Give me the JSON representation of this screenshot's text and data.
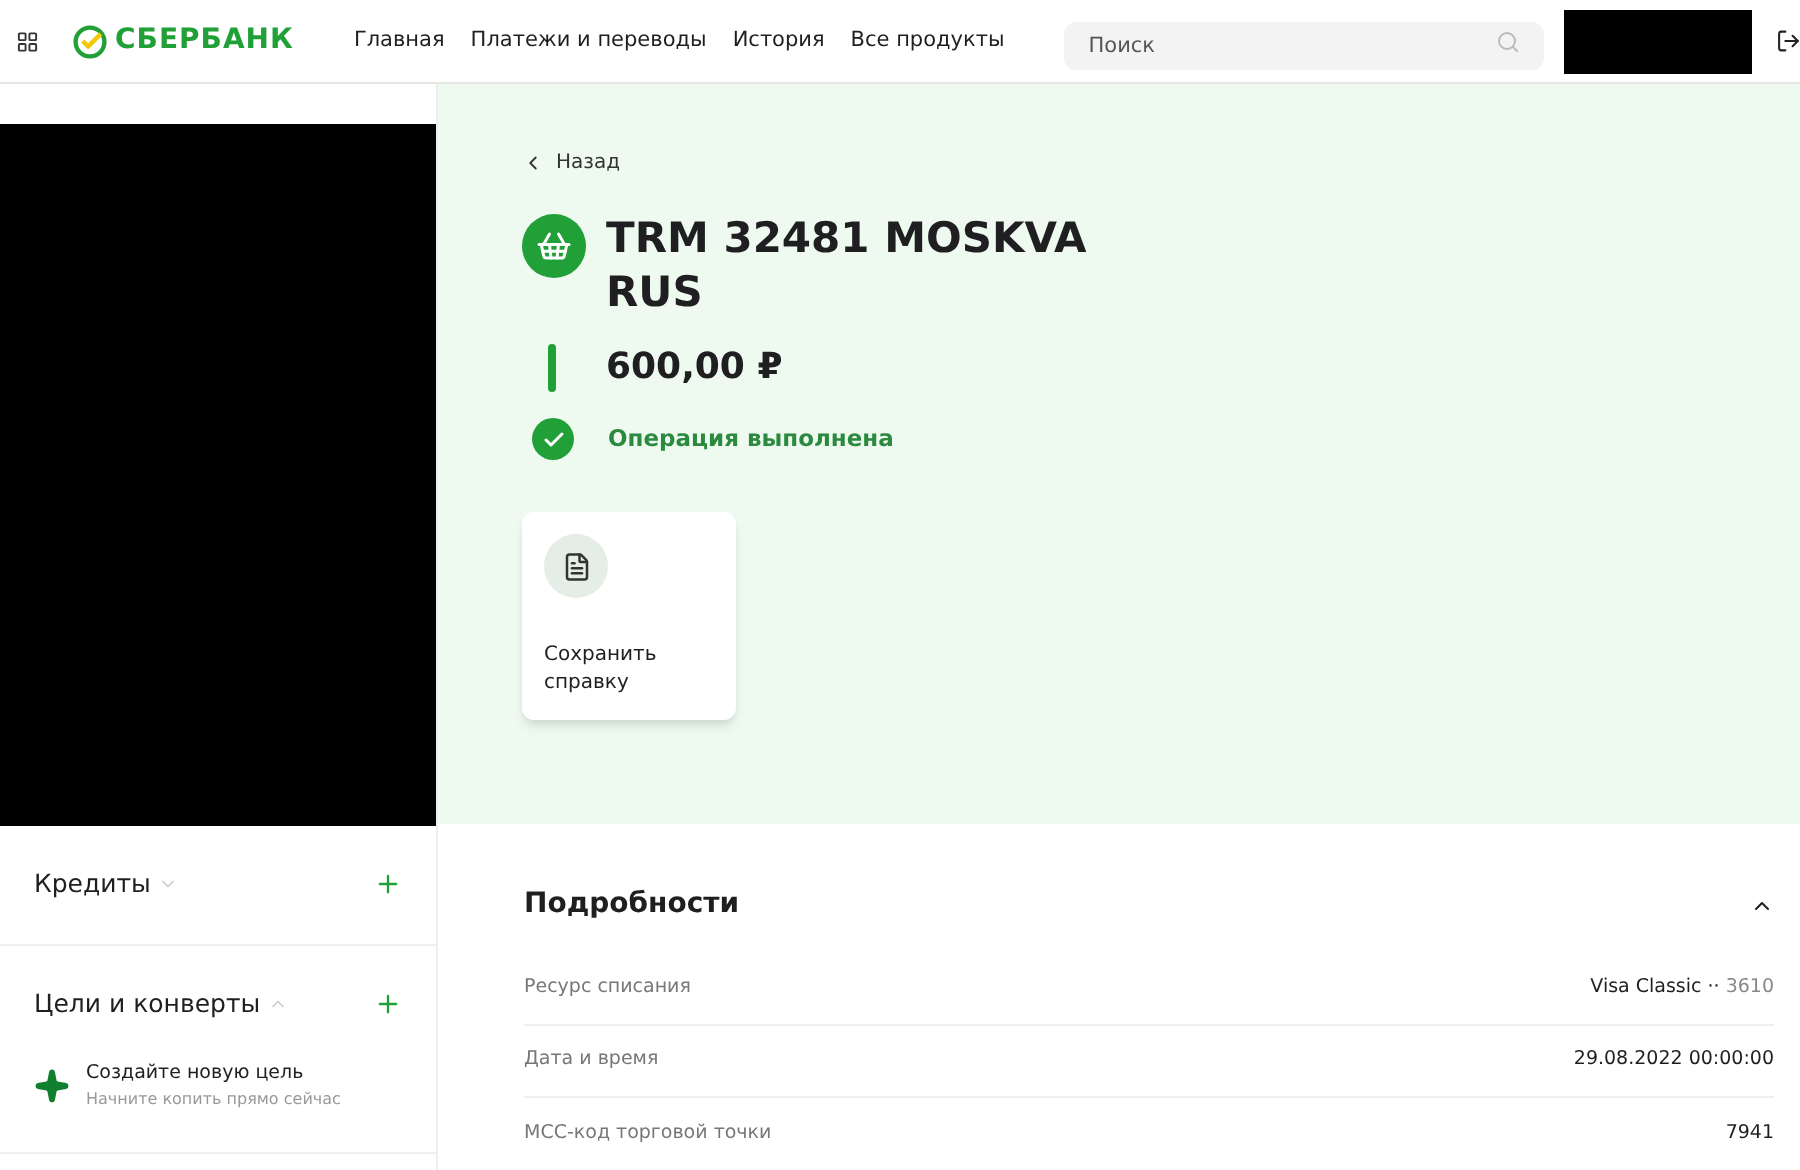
{
  "header": {
    "logo": "СБЕРБАНК",
    "nav": [
      "Главная",
      "Платежи и переводы",
      "История",
      "Все продукты"
    ],
    "search": {
      "placeholder": "Поиск"
    }
  },
  "sidebar": {
    "sections": [
      {
        "title": "Кредиты",
        "expanded": false
      },
      {
        "title": "Цели и конверты",
        "expanded": true,
        "items": [
          {
            "title": "Создайте новую цель",
            "subtitle": "Начните копить прямо сейчас"
          }
        ]
      }
    ]
  },
  "operation": {
    "back": "Назад",
    "title": "TRM 32481 MOSKVA RUS",
    "amount": "600,00 ₽",
    "status": "Операция выполнена",
    "actions": [
      "Сохранить справку"
    ]
  },
  "details": {
    "title": "Подробности",
    "expanded": true,
    "rows": [
      {
        "label": "Ресурс списания",
        "value": "Visa Classic ··",
        "value_suffix": "3610"
      },
      {
        "label": "Дата и время",
        "value": "29.08.2022 00:00:00"
      },
      {
        "label": "MCC-код торговой точки",
        "value": "7941"
      }
    ]
  }
}
